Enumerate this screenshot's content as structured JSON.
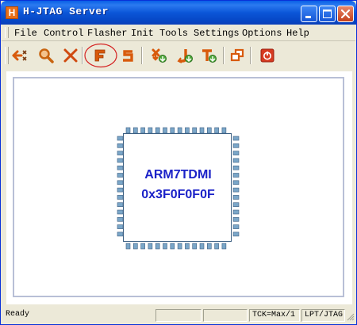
{
  "window": {
    "title": "H-JTAG Server",
    "app_icon_letter": "H"
  },
  "menu": {
    "items": [
      "File",
      "Control",
      "Flasher",
      "Init",
      "Tools",
      "Settings",
      "Options",
      "Help"
    ]
  },
  "toolbar": {
    "buttons": [
      {
        "icon": "detect-arrow-icon",
        "color": "#d85a0c"
      },
      {
        "icon": "search-icon",
        "color": "#c86410"
      },
      {
        "icon": "close-x-icon",
        "color": "#d04a10"
      },
      {
        "icon": "flasher-f-icon",
        "color": "#d85a0c",
        "highlighted": true
      },
      {
        "icon": "s-icon",
        "color": "#d85a0c"
      },
      {
        "icon": "tool-arrow-icon",
        "color": "#d85a0c"
      },
      {
        "icon": "j-arrow-icon",
        "color": "#d85a0c"
      },
      {
        "icon": "t-arrow-icon",
        "color": "#d85a0c"
      },
      {
        "icon": "window-icon",
        "color": "#d85a0c"
      },
      {
        "icon": "power-icon",
        "color": "#d63a20"
      }
    ]
  },
  "target": {
    "core": "ARM7TDMI",
    "id": "0x3F0F0F0F"
  },
  "status": {
    "state": "Ready",
    "pane2": "",
    "pane3": "",
    "tck": "TCK=Max/1",
    "interface": "LPT/JTAG"
  },
  "colors": {
    "accent": "#d85a0c",
    "chip_text": "#1b22c8",
    "title_bar": "#0b56d8"
  }
}
